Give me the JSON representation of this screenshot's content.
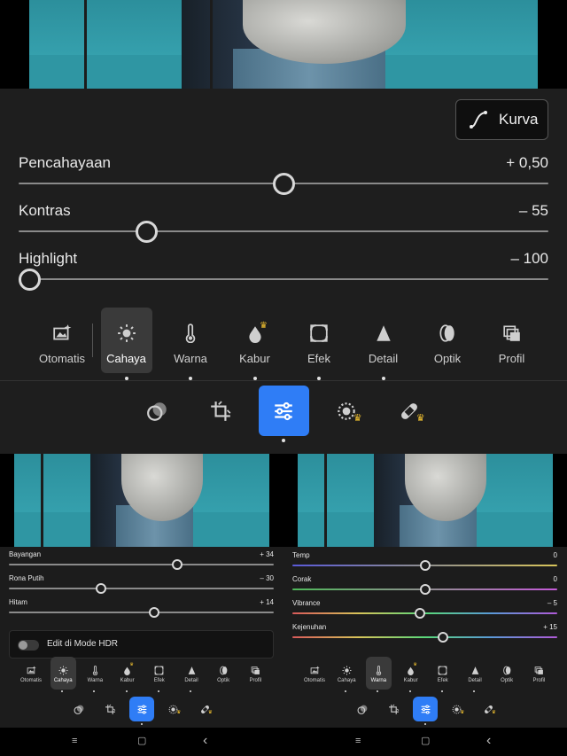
{
  "main": {
    "curve_button": "Kurva",
    "sliders": [
      {
        "label": "Pencahayaan",
        "value": "+ 0,50",
        "position": 0.5
      },
      {
        "label": "Kontras",
        "value": "– 55",
        "position": 0.23
      },
      {
        "label": "Highlight",
        "value": "– 100",
        "position": 0.0
      }
    ],
    "tabs": [
      "Otomatis",
      "Cahaya",
      "Warna",
      "Kabur",
      "Efek",
      "Detail",
      "Optik",
      "Profil"
    ],
    "selected_tab": "Cahaya"
  },
  "left": {
    "sliders": [
      {
        "label": "Bayangan",
        "value": "+ 34",
        "position": 0.64
      },
      {
        "label": "Rona Putih",
        "value": "– 30",
        "position": 0.34
      },
      {
        "label": "Hitam",
        "value": "+ 14",
        "position": 0.55
      }
    ],
    "hdr_toggle": "Edit di Mode HDR",
    "tabs": [
      "Otomatis",
      "Cahaya",
      "Warna",
      "Kabur",
      "Efek",
      "Detail",
      "Optik",
      "Profil"
    ],
    "selected_tab": "Cahaya"
  },
  "right": {
    "sliders": [
      {
        "label": "Temp",
        "value": "0",
        "position": 0.5
      },
      {
        "label": "Corak",
        "value": "0",
        "position": 0.5
      },
      {
        "label": "Vibrance",
        "value": "– 5",
        "position": 0.48
      },
      {
        "label": "Kejenuhan",
        "value": "+ 15",
        "position": 0.57
      }
    ],
    "tabs": [
      "Otomatis",
      "Cahaya",
      "Warna",
      "Kabur",
      "Efek",
      "Detail",
      "Optik",
      "Profil"
    ],
    "selected_tab": "Warna"
  },
  "colors": {
    "accent": "#2f7df6",
    "premium": "#f2c230"
  }
}
